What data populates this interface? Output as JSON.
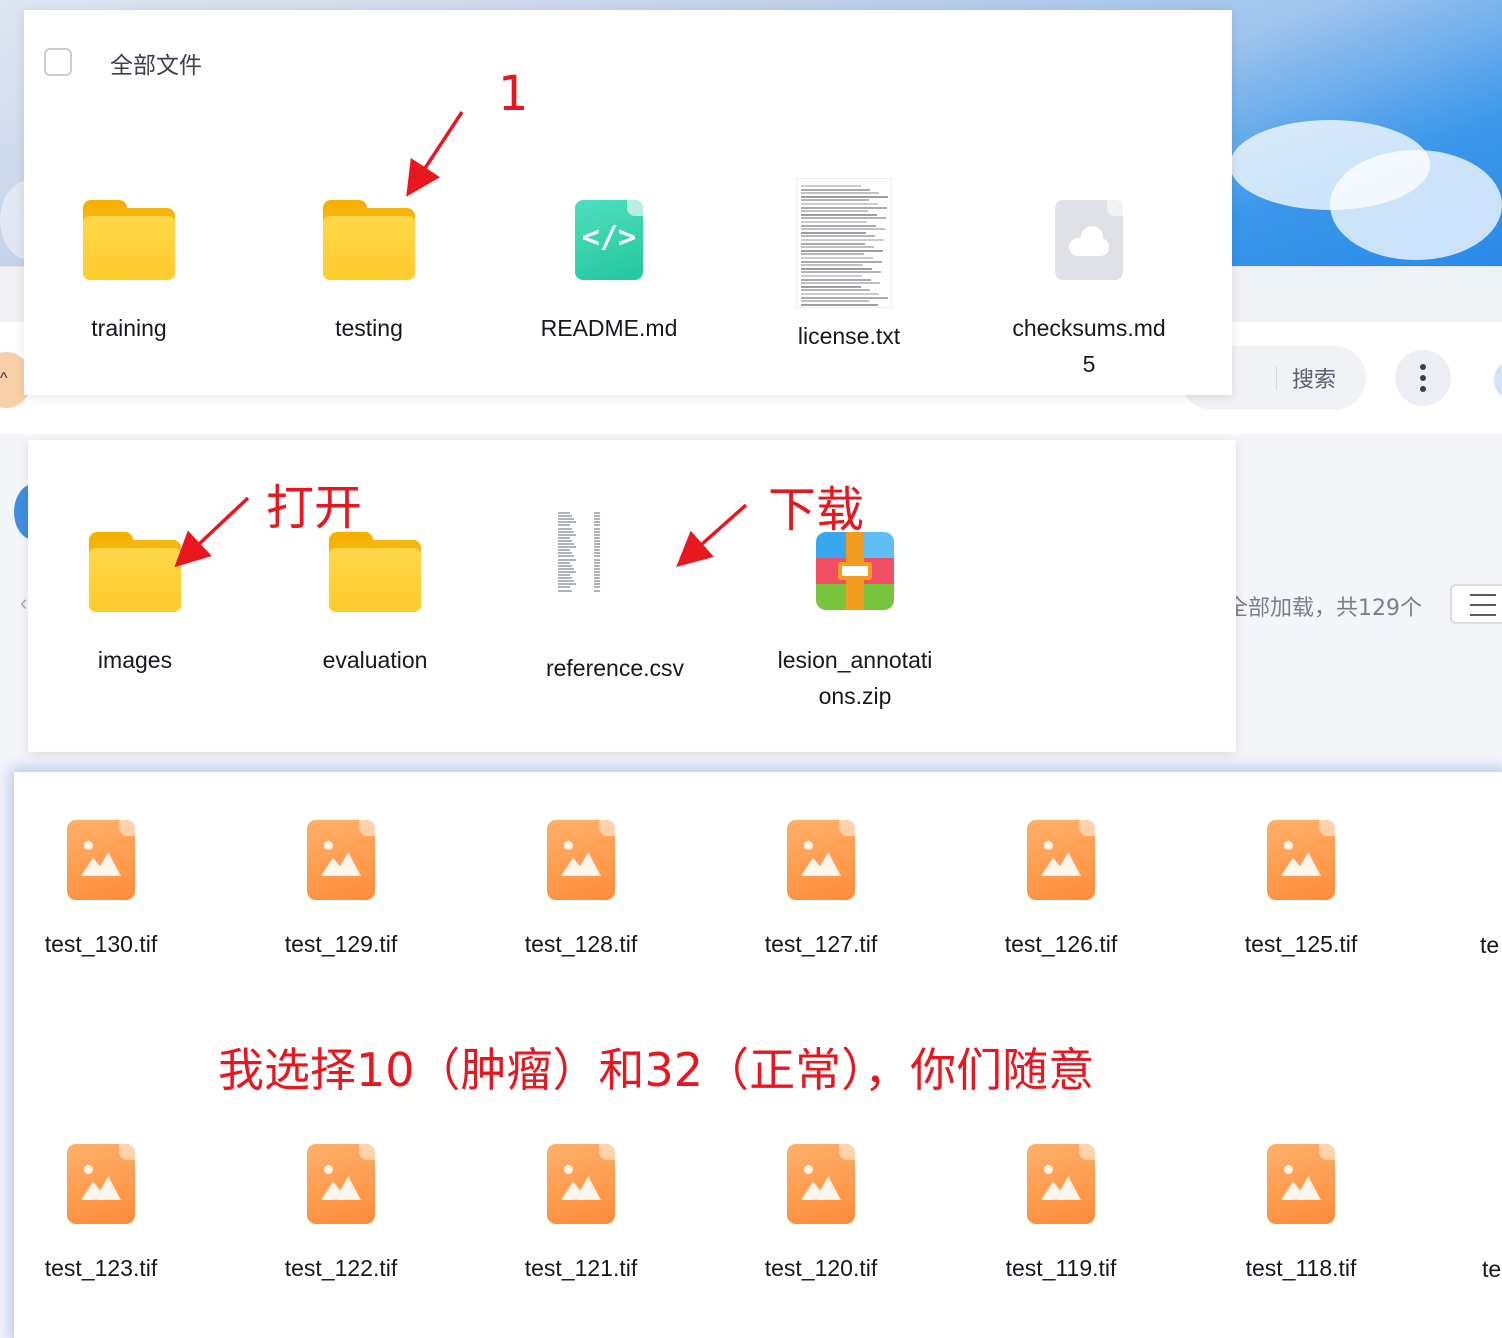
{
  "background": {
    "search_label": "搜索",
    "count_text": "全部加载，共129个"
  },
  "panel_1": {
    "select_all_label": "全部文件",
    "items": [
      {
        "name": "training",
        "icon": "folder-icon"
      },
      {
        "name": "testing",
        "icon": "folder-icon"
      },
      {
        "name": "README.md",
        "icon": "code-file-icon"
      },
      {
        "name": "license.txt",
        "icon": "text-thumbnail"
      },
      {
        "name_line1": "checksums.md",
        "name_line2": "5",
        "icon": "cloud-file-icon"
      }
    ]
  },
  "panel_2": {
    "items": [
      {
        "name": "images",
        "icon": "folder-icon"
      },
      {
        "name": "evaluation",
        "icon": "folder-icon"
      },
      {
        "name": "reference.csv",
        "icon": "csv-thumbnail"
      },
      {
        "name_line1": "lesion_annotati",
        "name_line2": "ons.zip",
        "icon": "zip-icon"
      }
    ]
  },
  "panel_3": {
    "row_1": [
      "test_130.tif",
      "test_129.tif",
      "test_128.tif",
      "test_127.tif",
      "test_126.tif",
      "test_125.tif"
    ],
    "row_1_cut": "te",
    "row_2": [
      "test_123.tif",
      "test_122.tif",
      "test_121.tif",
      "test_120.tif",
      "test_119.tif",
      "test_118.tif"
    ],
    "row_2_cut": "te",
    "file_icon": "image-file-icon"
  },
  "annotations": {
    "step_number": "1",
    "open_label": "打开",
    "download_label": "下载",
    "message": "我选择10（肿瘤）和32（正常），你们随意",
    "color": "#e8171f"
  }
}
